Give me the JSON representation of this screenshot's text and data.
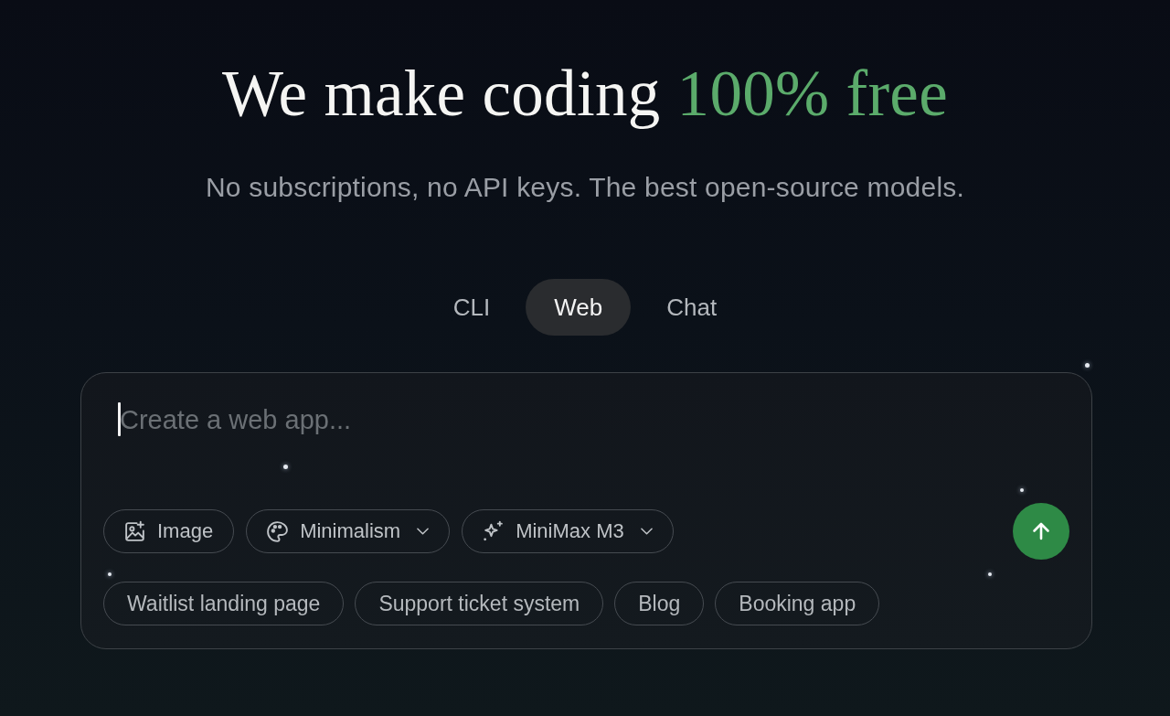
{
  "hero": {
    "title": "We make coding",
    "title_accent": "100% free",
    "subtitle": "No subscriptions, no API keys. The best open-source models."
  },
  "tabs": [
    {
      "label": "CLI",
      "selected": false
    },
    {
      "label": "Web",
      "selected": true
    },
    {
      "label": "Chat",
      "selected": false
    }
  ],
  "composer": {
    "placeholder": "Create a web app...",
    "tools": [
      {
        "kind": "button",
        "label": "Image"
      },
      {
        "kind": "dropdown",
        "label": "Minimalism"
      },
      {
        "kind": "dropdown",
        "label": "MiniMax M3"
      }
    ],
    "suggestions": [
      "Waitlist landing page",
      "Support ticket system",
      "Blog",
      "Booking app"
    ]
  }
}
